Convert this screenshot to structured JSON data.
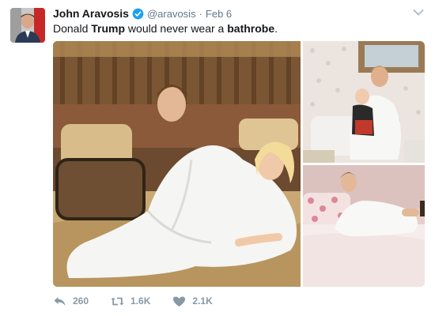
{
  "tweet": {
    "author_name": "John Aravosis",
    "handle": "@aravosis",
    "separator": "·",
    "date": "Feb 6",
    "text": {
      "part1": "Donald ",
      "bold1": "Trump",
      "part2": " would never wear a ",
      "bold2": "bathrobe",
      "part3": "."
    },
    "verified": true,
    "media_count": 3
  },
  "actions": {
    "reply": {
      "icon": "reply-icon",
      "count": "260"
    },
    "retweet": {
      "icon": "retweet-icon",
      "count": "1.6K"
    },
    "like": {
      "icon": "heart-icon",
      "count": "2.1K"
    }
  },
  "colors": {
    "verified_blue": "#1da1f2",
    "muted_text": "#657786",
    "action_gray": "#8899a6",
    "primary_text": "#14171a"
  }
}
